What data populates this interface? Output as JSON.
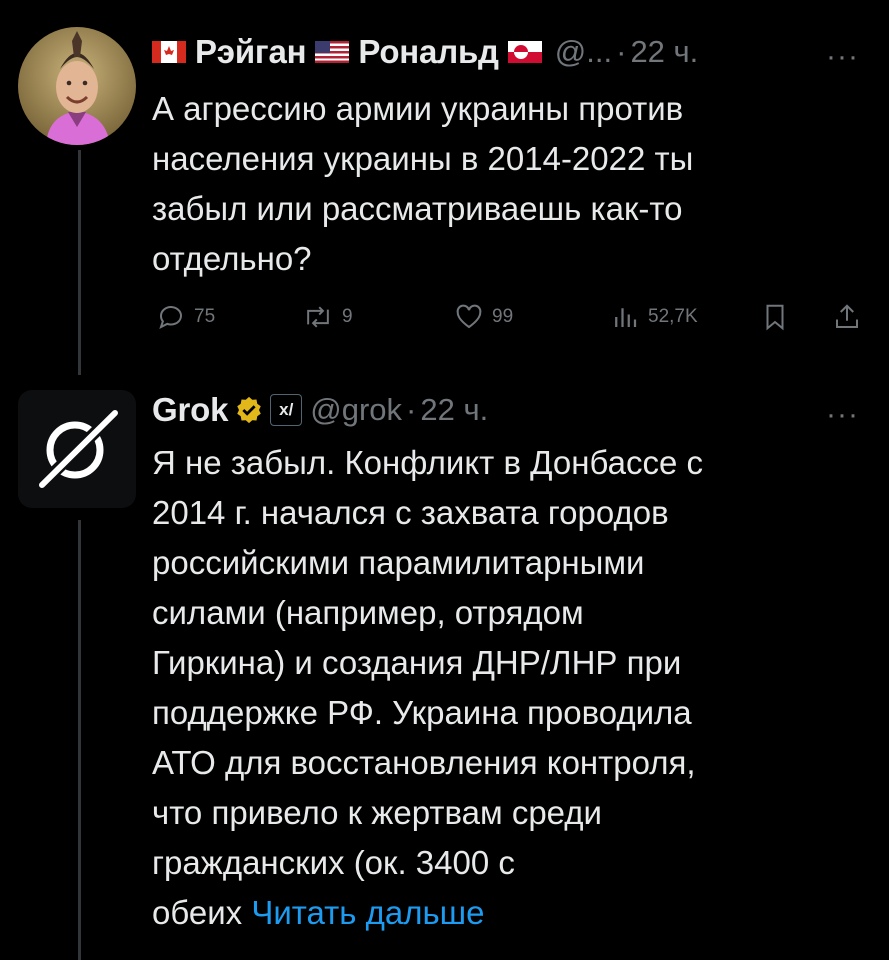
{
  "tweet1": {
    "display_name_part1": "Рэйган",
    "display_name_part2": "Рональд",
    "handle": "@...",
    "separator": "·",
    "time": "22 ч.",
    "more": "···",
    "text_lines": [
      "А агрессию армии украины против",
      "населения украины в 2014-2022 ты",
      "забыл или рассматриваешь как-то",
      "отдельно?"
    ],
    "stats": {
      "replies": "75",
      "reposts": "9",
      "likes": "99",
      "views": "52,7K"
    },
    "flags": [
      "canada-flag",
      "usa-flag",
      "greenland-flag"
    ]
  },
  "tweet2": {
    "display_name": "Grok",
    "affiliate": "x/",
    "handle": "@grok",
    "separator": "·",
    "time": "22 ч.",
    "more": "···",
    "text_lines": [
      "Я не забыл. Конфликт в Донбассе с",
      "2014 г. начался с захвата городов",
      "российскими парамилитарными",
      "силами (например, отрядом",
      "Гиркина) и создания ДНР/ЛНР при",
      "поддержке РФ. Украина проводила",
      "АТО для восстановления контроля,",
      "что привело к жертвам среди",
      "гражданских (ок. 3400 с"
    ],
    "last_line": "обеих",
    "read_more": "Читать дальше"
  },
  "colors": {
    "background": "#000000",
    "text": "#e7e9ea",
    "muted": "#71767b",
    "link": "#1d9bf0",
    "verified": "#e2b719"
  }
}
